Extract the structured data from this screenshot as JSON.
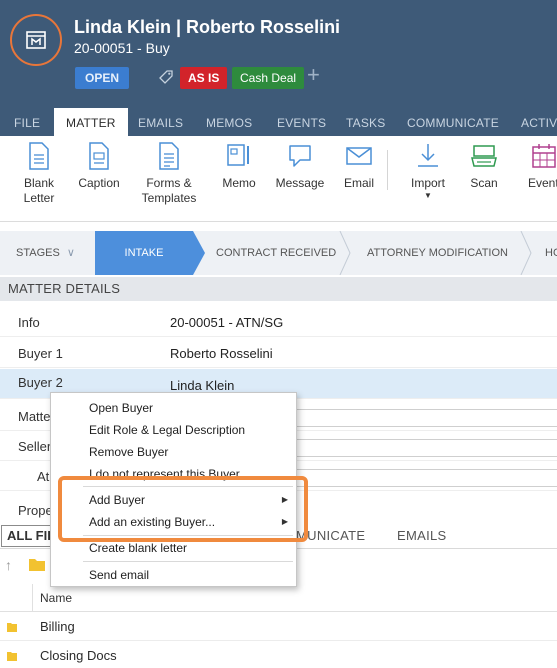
{
  "header": {
    "title": "Linda Klein | Roberto Rosselini",
    "subtitle": "20-00051 - Buy",
    "status_badge": "OPEN",
    "tags": [
      "AS IS",
      "Cash Deal"
    ],
    "add_tag_symbol": "+",
    "logo_icon": "matter-building-icon",
    "colors": {
      "header_bg": "#3e5a78",
      "open": "#3b7dd0",
      "as_is": "#d2232a",
      "cash_deal": "#2e8b3d",
      "logo_ring": "#e8763a"
    }
  },
  "tabs": [
    "FILE",
    "MATTER",
    "EMAILS",
    "MEMOS",
    "EVENTS",
    "TASKS",
    "COMMUNICATE",
    "ACTIVI"
  ],
  "active_tab": "MATTER",
  "ribbon": {
    "blank_letter": "Blank Letter",
    "caption": "Caption",
    "forms_templates": "Forms & Templates",
    "memo": "Memo",
    "message": "Message",
    "email": "Email",
    "import": "Import",
    "scan": "Scan",
    "events": "Event"
  },
  "stages": {
    "label": "STAGES",
    "items": [
      "INTAKE",
      "CONTRACT RECEIVED",
      "ATTORNEY MODIFICATION",
      "HO"
    ],
    "active": "INTAKE"
  },
  "matter_details": {
    "title": "MATTER DETAILS",
    "rows": [
      {
        "label": "Info",
        "value": "20-00051 - ATN/SG"
      },
      {
        "label": "Buyer 1",
        "value": "Roberto Rosselini"
      },
      {
        "label": "Buyer 2",
        "value": "Linda Klein"
      },
      {
        "label": "Matte",
        "value": ""
      },
      {
        "label": "Seller",
        "value": ""
      },
      {
        "label": "At",
        "value": ""
      },
      {
        "label": "Prope",
        "value": ""
      }
    ]
  },
  "lower_tabs": {
    "all_files": "ALL FIL",
    "communicate": "MUNICATE",
    "emails": "EMAILS"
  },
  "files": {
    "name_header": "Name",
    "items": [
      "Billing",
      "Closing Docs"
    ]
  },
  "context_menu": {
    "items": [
      "Open Buyer",
      "Edit Role & Legal Description",
      "Remove Buyer",
      "I do not represent this Buyer",
      "Add Buyer",
      "Add an existing Buyer...",
      "Create blank letter",
      "Send email"
    ]
  }
}
